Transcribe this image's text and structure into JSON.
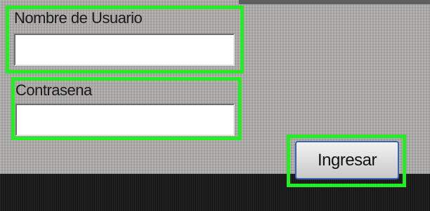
{
  "login": {
    "username_label": "Nombre de Usuario",
    "username_value": "",
    "password_label": "Contrasena",
    "password_value": "",
    "submit_label": "Ingresar"
  },
  "colors": {
    "highlight": "#22ee22",
    "panel": "#a9a6a6",
    "dark_strip": "#141414",
    "button_border": "#3a63b8"
  }
}
